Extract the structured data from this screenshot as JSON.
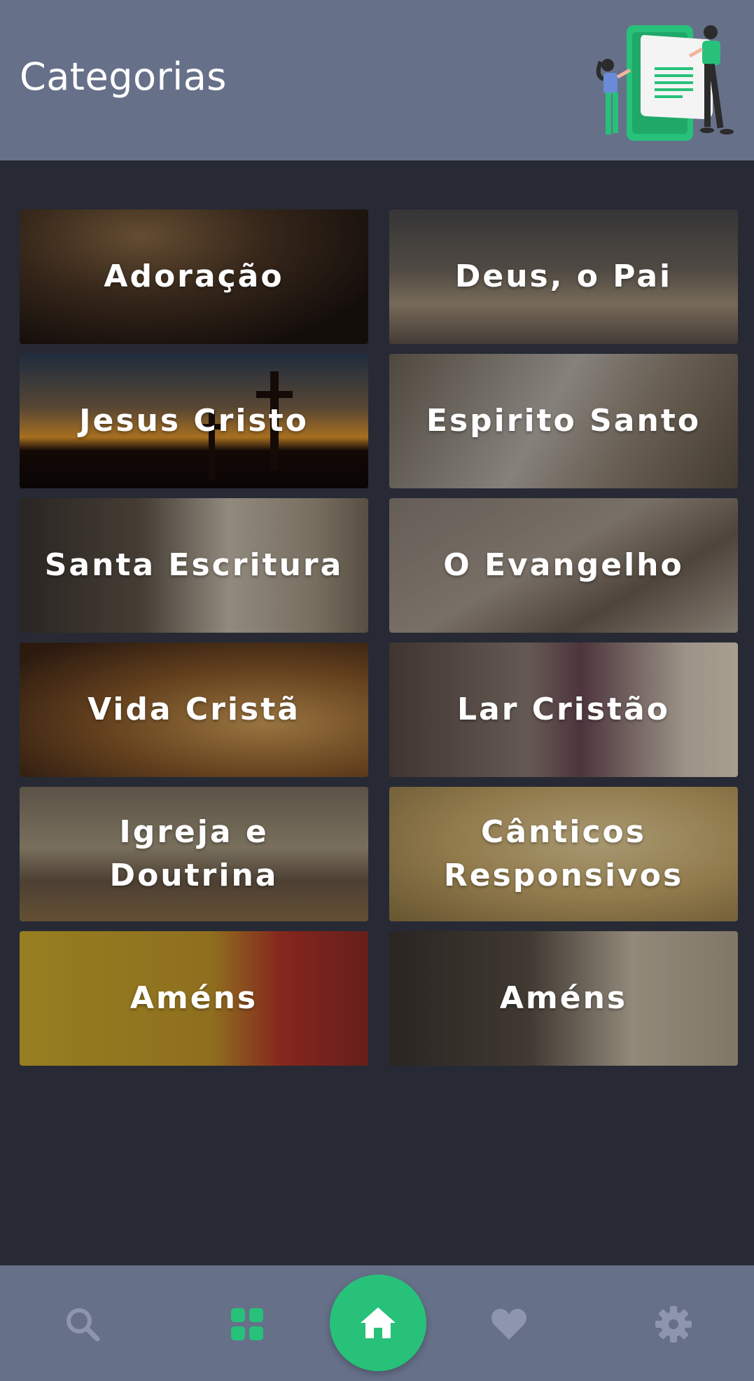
{
  "header": {
    "title": "Categorias",
    "illustration_icon": "people-with-document-illustration"
  },
  "categories": [
    {
      "label": "Adoração"
    },
    {
      "label": "Deus, o Pai"
    },
    {
      "label": "Jesus Cristo"
    },
    {
      "label": "Espirito Santo"
    },
    {
      "label": "Santa Escritura"
    },
    {
      "label": "O Evangelho"
    },
    {
      "label": "Vida Cristã"
    },
    {
      "label": "Lar Cristão"
    },
    {
      "label": "Igreja e Doutrina"
    },
    {
      "label": "Cânticos Responsivos"
    },
    {
      "label": "Améns"
    },
    {
      "label": "Améns"
    }
  ],
  "bottom_nav": {
    "items": [
      {
        "icon": "search-icon",
        "active": false
      },
      {
        "icon": "grid-icon",
        "active": true
      },
      {
        "icon": "home-icon",
        "active": false
      },
      {
        "icon": "heart-icon",
        "active": false
      },
      {
        "icon": "gear-icon",
        "active": false
      }
    ]
  },
  "colors": {
    "header_bg": "#667089",
    "page_bg": "#272a34",
    "accent": "#27c17a",
    "nav_inactive": "#8e96ad"
  }
}
